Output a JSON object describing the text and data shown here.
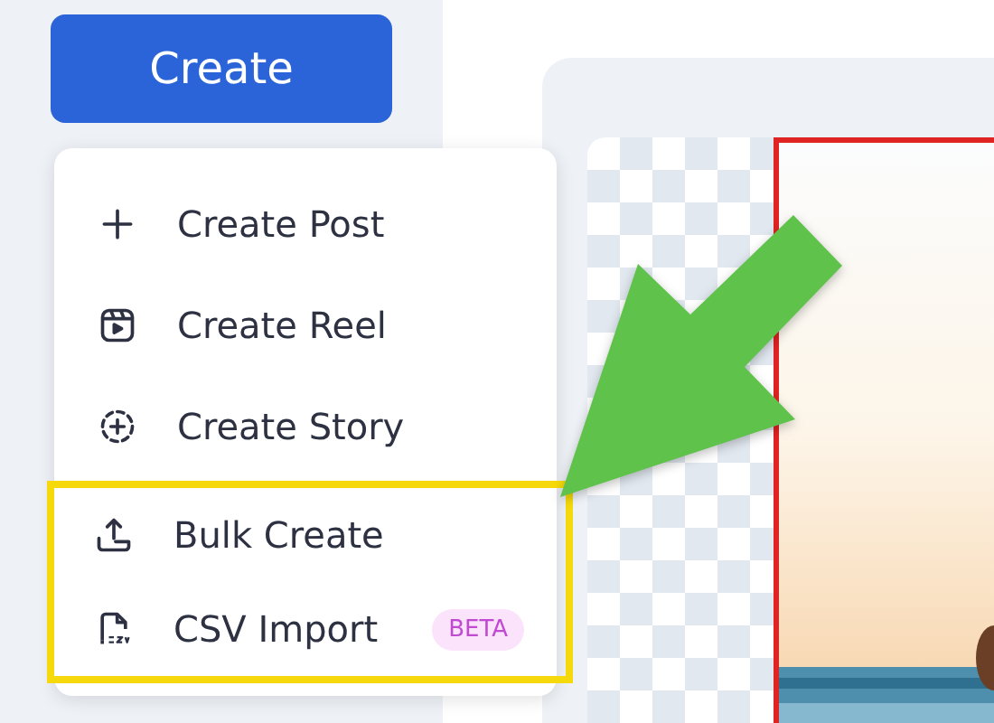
{
  "create_button": {
    "label": "Create"
  },
  "menu": {
    "items": [
      {
        "kind": "plus",
        "label": "Create Post",
        "highlighted": false
      },
      {
        "kind": "reel",
        "label": "Create Reel",
        "highlighted": false
      },
      {
        "kind": "story",
        "label": "Create Story",
        "highlighted": false
      },
      {
        "kind": "upload",
        "label": "Bulk Create",
        "highlighted": true
      },
      {
        "kind": "csv",
        "label": "CSV Import",
        "badge": "BETA",
        "highlighted": true
      }
    ]
  }
}
